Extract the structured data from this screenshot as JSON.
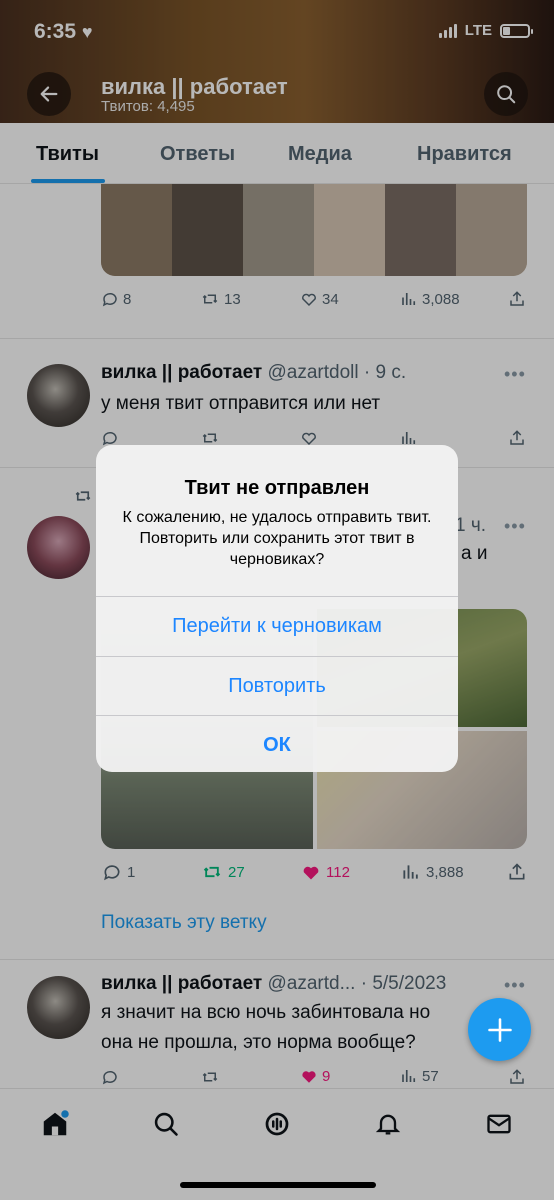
{
  "status_bar": {
    "time": "6:35",
    "network": "LTE"
  },
  "header": {
    "profile_name": "вилка || работает",
    "tweet_count": "Твитов: 4,495"
  },
  "tabs": [
    {
      "label": "Твиты",
      "active": true
    },
    {
      "label": "Ответы",
      "active": false
    },
    {
      "label": "Медиа",
      "active": false
    },
    {
      "label": "Нравится",
      "active": false
    }
  ],
  "tweets": [
    {
      "replies": "8",
      "retweets": "13",
      "likes": "34",
      "views": "3,088"
    },
    {
      "name": "вилка || работает",
      "handle": "@azartdoll",
      "time": "· 9 с.",
      "text": "у меня твит отправится или нет"
    },
    {
      "time_fragment": "1 ч.",
      "text_fragment": "а и",
      "replies": "1",
      "retweets": "27",
      "likes": "112",
      "views": "3,888",
      "show_thread": "Показать эту ветку"
    },
    {
      "name": "вилка || работает",
      "handle": "@azartd...",
      "time": "· 5/5/2023",
      "text_line1": "я значит на всю ночь забинтовала но",
      "text_line2": "она не прошла, это норма вообще?",
      "likes": "9",
      "views": "57"
    }
  ],
  "alert": {
    "title": "Твит не отправлен",
    "message": "К сожалению, не удалось отправить твит. Повторить или сохранить этот твит в черновиках?",
    "buttons": [
      "Перейти к черновикам",
      "Повторить",
      "ОК"
    ]
  },
  "colors": {
    "accent": "#1d9bf0",
    "retweet": "#00ba7c",
    "like": "#f91880",
    "alert_button": "#1d86ff"
  }
}
